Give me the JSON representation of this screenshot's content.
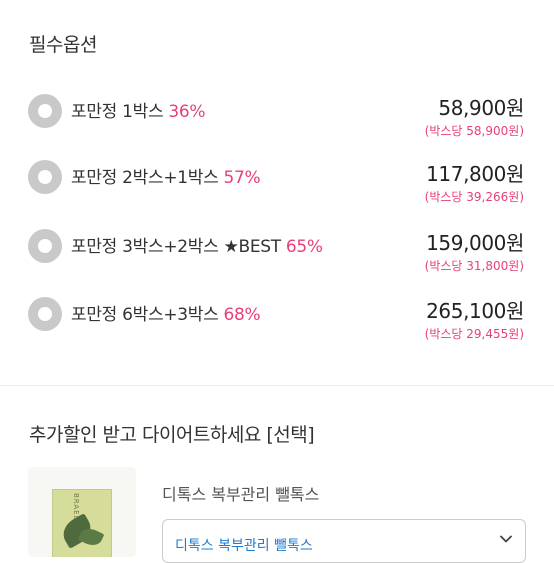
{
  "required_options": {
    "title": "필수옵션",
    "items": [
      {
        "label": "포만정 1박스",
        "discount": "36%",
        "price": "58,900원",
        "unit_price": "(박스당 58,900원)"
      },
      {
        "label": "포만정 2박스+1박스",
        "discount": "57%",
        "price": "117,800원",
        "unit_price": "(박스당 39,266원)"
      },
      {
        "label": "포만정 3박스+2박스 ★BEST",
        "discount": "65%",
        "price": "159,000원",
        "unit_price": "(박스당 31,800원)"
      },
      {
        "label": "포만정 6박스+3박스",
        "discount": "68%",
        "price": "265,100원",
        "unit_price": "(박스당 29,455원)"
      }
    ]
  },
  "addon": {
    "title": "추가할인 받고 다이어트하세요 [선택]",
    "product_name": "디톡스 복부관리 뺄톡스",
    "product_box_text": "BRAELTON",
    "select_value": "디톡스 복부관리 뺄톡스"
  },
  "colors": {
    "accent": "#e8407a",
    "link": "#1f7bd1",
    "radio": "#c9c9c9"
  }
}
